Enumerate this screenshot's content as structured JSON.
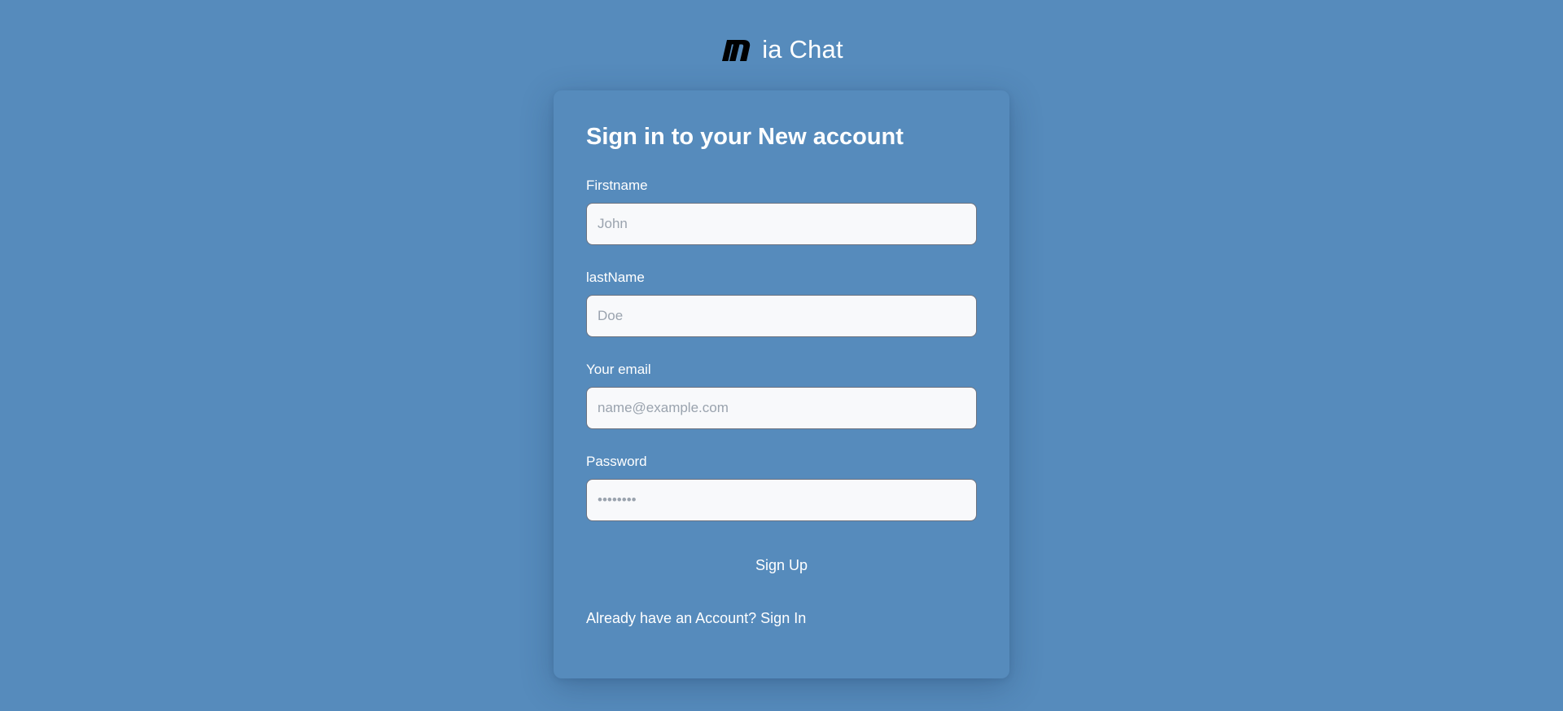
{
  "brand": {
    "logo_icon": "m-logo-icon",
    "name": "ia Chat"
  },
  "form": {
    "title": "Sign in to your New account",
    "fields": [
      {
        "label": "Firstname",
        "placeholder": "John",
        "type": "text"
      },
      {
        "label": "lastName",
        "placeholder": "Doe",
        "type": "text"
      },
      {
        "label": "Your email",
        "placeholder": "name@example.com",
        "type": "email"
      },
      {
        "label": "Password",
        "placeholder": "••••••••",
        "type": "password"
      }
    ],
    "submit_label": "Sign Up",
    "signin_prompt": "Already have an Account?",
    "signin_link": "Sign In"
  },
  "colors": {
    "background": "#568bbc",
    "input_background": "#f8f9fb",
    "text": "#ffffff"
  }
}
